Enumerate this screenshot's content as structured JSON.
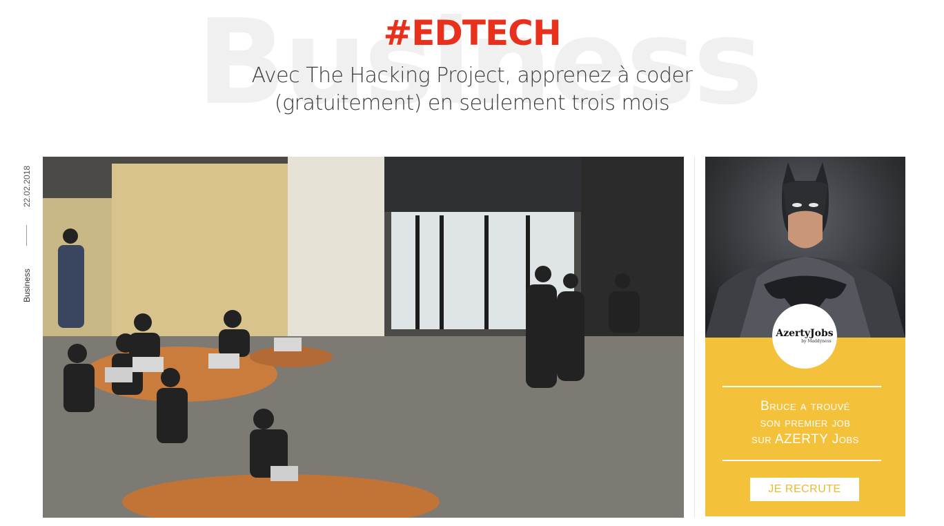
{
  "article": {
    "background_word": "Business",
    "tag": "#EDTECH",
    "headline_line1": "Avec The Hacking Project, apprenez à coder",
    "headline_line2": "(gratuitement) en seulement trois mois",
    "date": "22.02.2018",
    "category": "Business",
    "hero_image": "photo-coworking-space-students-laptops"
  },
  "ad": {
    "image": "batman-illustration",
    "logo_name": "AzertyJobs",
    "logo_sub": "by Maddyness",
    "message_line1": "Bruce a trouvé",
    "message_line2": "son premier job",
    "message_line3": "sur AZERTY Jobs",
    "cta_label": "JE RECRUTE",
    "colors": {
      "background": "#f3c13a",
      "cta_text": "#f0b82e"
    }
  },
  "colors": {
    "accent": "#e8311c"
  }
}
